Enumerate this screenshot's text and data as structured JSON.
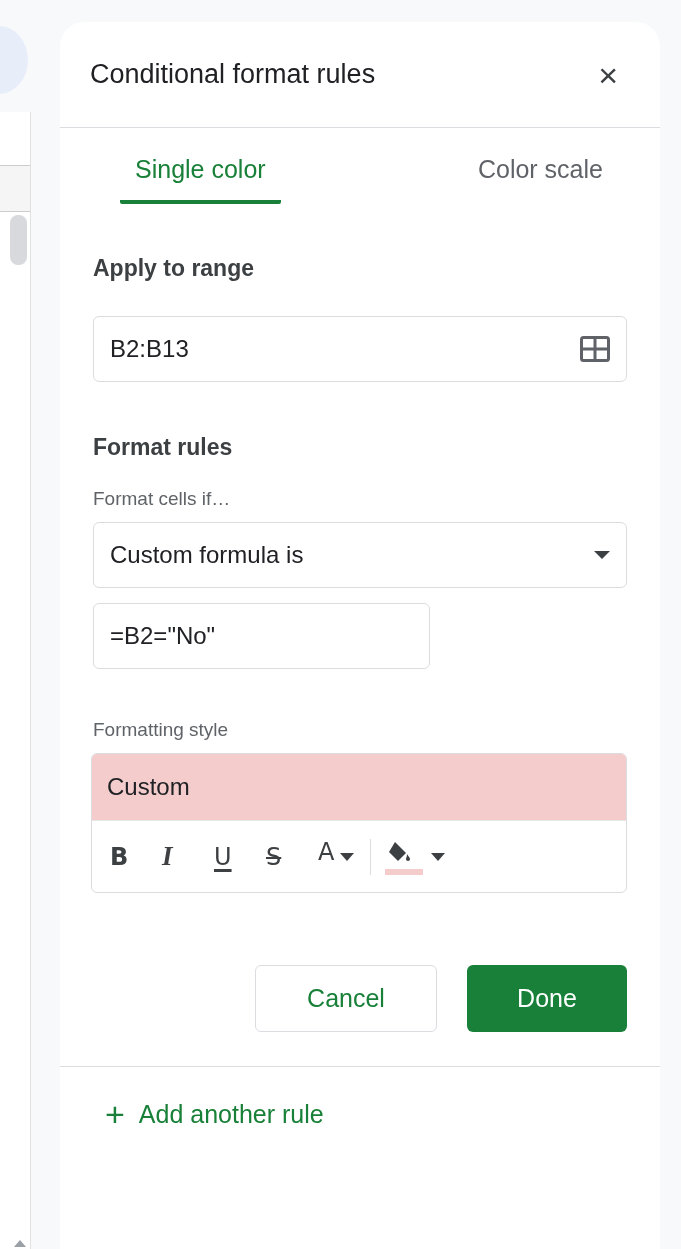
{
  "panel": {
    "title": "Conditional format rules",
    "close": "×"
  },
  "tabs": [
    {
      "label": "Single color",
      "selected": true
    },
    {
      "label": "Color scale",
      "selected": false
    }
  ],
  "apply_to_range": {
    "heading": "Apply to range",
    "value": "B2:B13"
  },
  "format_rules": {
    "heading": "Format rules",
    "condition_label": "Format cells if…",
    "condition": "Custom formula is",
    "formula": "=B2=\"No\""
  },
  "formatting_style": {
    "label": "Formatting style",
    "preview": "Custom",
    "toolbar": [
      "B",
      "I",
      "U",
      "S",
      "A"
    ]
  },
  "buttons": {
    "cancel": "Cancel",
    "done": "Done"
  },
  "add_rule": {
    "icon": "+",
    "label": "Add another rule"
  }
}
